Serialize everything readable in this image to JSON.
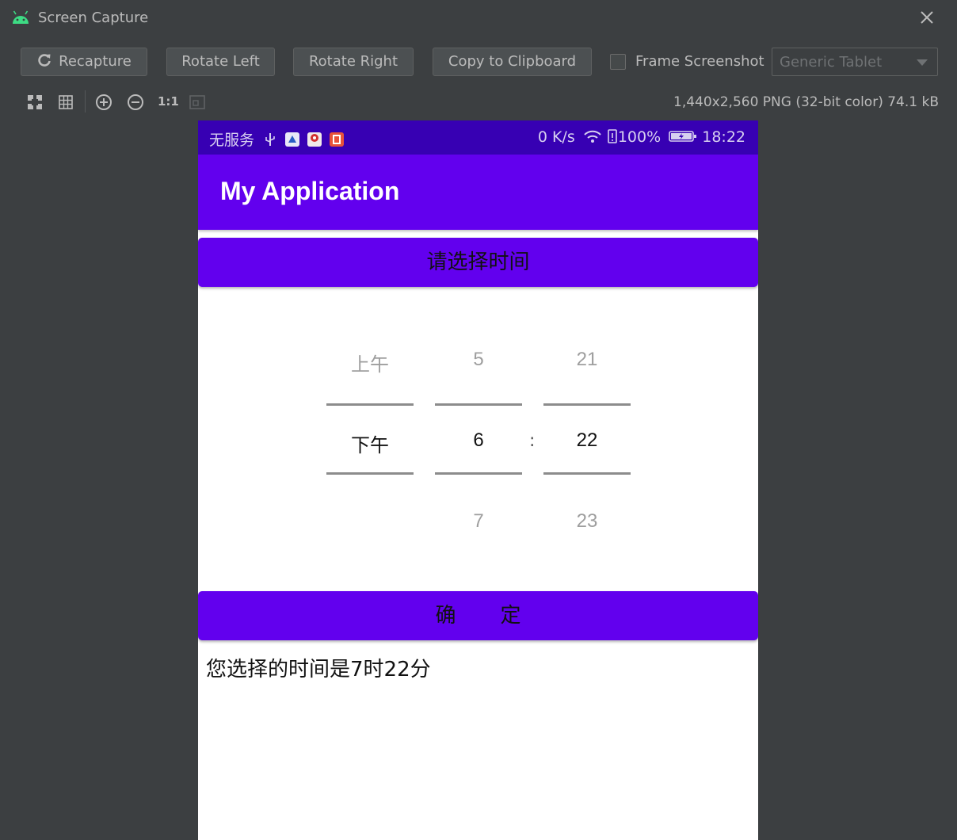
{
  "window": {
    "title": "Screen Capture",
    "icon": "android-icon",
    "close_icon": "close-icon"
  },
  "toolbar": {
    "recapture_label": "Recapture",
    "rotate_left_label": "Rotate Left",
    "rotate_right_label": "Rotate Right",
    "copy_label": "Copy to Clipboard",
    "frame_screenshot_label": "Frame Screenshot",
    "frame_screenshot_checked": false,
    "device_select_value": "Generic Tablet"
  },
  "view_controls": {
    "zoom_actual_label": "1:1",
    "image_info": "1,440x2,560 PNG (32-bit color) 74.1 kB"
  },
  "device": {
    "status_left": "无服务",
    "status_speed": "0 K/s",
    "status_battery": "100%",
    "status_time": "18:22",
    "app_title": "My Application",
    "accent_color": "#6200ee",
    "status_color": "#3700b3",
    "pick_button_label": "请选择时间",
    "time_picker": {
      "ampm": {
        "above": "上午",
        "selected": "下午",
        "below": ""
      },
      "hour": {
        "above": "5",
        "selected": "6",
        "below": "7"
      },
      "separator": ":",
      "minute": {
        "above": "21",
        "selected": "22",
        "below": "23"
      }
    },
    "confirm_button_label": "确定",
    "result_text": "您选择的时间是7时22分"
  }
}
